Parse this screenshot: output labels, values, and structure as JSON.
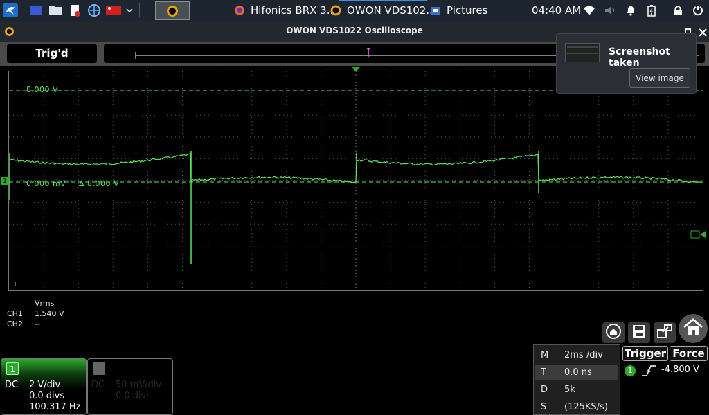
{
  "taskbar": {
    "tasks": [
      {
        "label": "Hifonics BRX 3..."
      },
      {
        "label": "OWON VDS102..."
      },
      {
        "label": "Pictures"
      }
    ],
    "clock": "04:40 AM"
  },
  "window": {
    "title": "OWON VDS1022 Oscilloscope"
  },
  "status": {
    "trigger_state": "Trig'd"
  },
  "notification": {
    "message": "Screenshot taken",
    "button": "View image"
  },
  "screen": {
    "cursor_top_label": "8.000 V",
    "cursor_bottom_label": "0.000 mV",
    "delta_label": "Δ 8.000 V",
    "ch1_marker": "1",
    "corner_marker": "II"
  },
  "measurements": {
    "header": "Vrms",
    "rows": [
      {
        "channel": "CH1",
        "value": "1.540 V"
      },
      {
        "channel": "CH2",
        "value": "--"
      }
    ]
  },
  "channel1": {
    "number": "1",
    "coupling": "DC",
    "volts_div": "2 V/div",
    "offset": "0.0 divs",
    "frequency": "100.317 Hz"
  },
  "channel2": {
    "coupling": "DC",
    "volts_div": "50 mV/div",
    "offset": "0.0 divs"
  },
  "timebase": {
    "rows": [
      {
        "key": "M",
        "value": "2ms /div"
      },
      {
        "key": "T",
        "value": "0.0 ns"
      },
      {
        "key": "D",
        "value": "5k"
      },
      {
        "key": "S",
        "value": "(125KS/s)"
      }
    ]
  },
  "trigger": {
    "trigger_label": "Trigger",
    "force_label": "Force",
    "channel": "1",
    "level": "-4.800 V"
  },
  "colors": {
    "trace": "#5ee65e",
    "ch1": "#2ea82e",
    "taskbar": "#1d2531",
    "accent": "#e6a30a"
  },
  "icons": [
    "app-menu-icon",
    "workspace-icon",
    "file-manager-icon",
    "document-icon",
    "browser-icon",
    "flag-icon",
    "chevron-down-icon",
    "firefox-icon",
    "owon-icon",
    "pictures-icon",
    "wifi-icon",
    "volume-icon",
    "bell-icon",
    "battery-icon",
    "lock-icon",
    "power-icon"
  ]
}
